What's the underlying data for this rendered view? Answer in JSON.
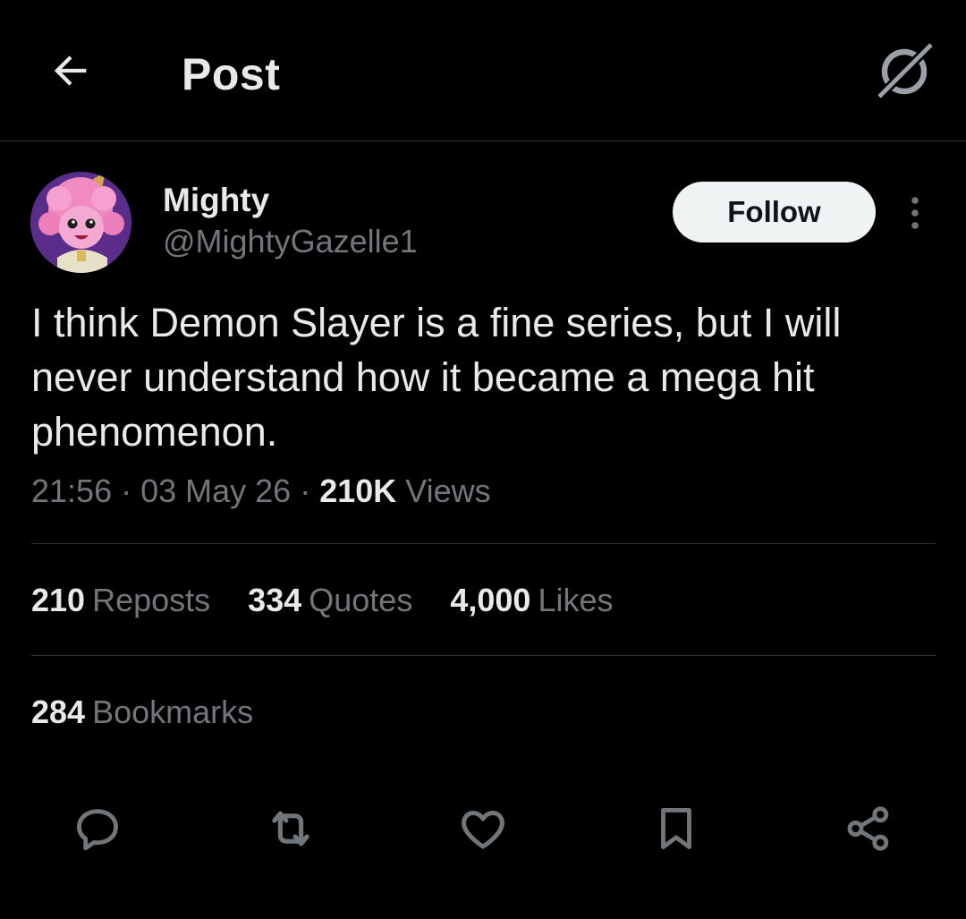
{
  "header": {
    "title": "Post",
    "back_icon": "arrow-left-icon",
    "grok_icon": "grok-icon"
  },
  "author": {
    "display_name": "Mighty",
    "handle": "@MightyGazelle1",
    "follow_label": "Follow"
  },
  "tweet": {
    "text": "I think Demon Slayer is a fine series, but I will never understand how it became a mega hit phenomenon.",
    "time": "21:56",
    "separator": " · ",
    "date": "03 May 26",
    "views_count": "210K",
    "views_label": "Views"
  },
  "stats": {
    "reposts_count": "210",
    "reposts_label": "Reposts",
    "quotes_count": "334",
    "quotes_label": "Quotes",
    "likes_count": "4,000",
    "likes_label": "Likes",
    "bookmarks_count": "284",
    "bookmarks_label": "Bookmarks"
  },
  "actions": [
    "reply-icon",
    "repost-icon",
    "like-icon",
    "bookmark-icon",
    "share-icon"
  ],
  "colors": {
    "background": "#000000",
    "text_primary": "#e7e9ea",
    "text_secondary": "#71767b",
    "divider": "#2f3336",
    "follow_bg": "#eff3f4"
  }
}
